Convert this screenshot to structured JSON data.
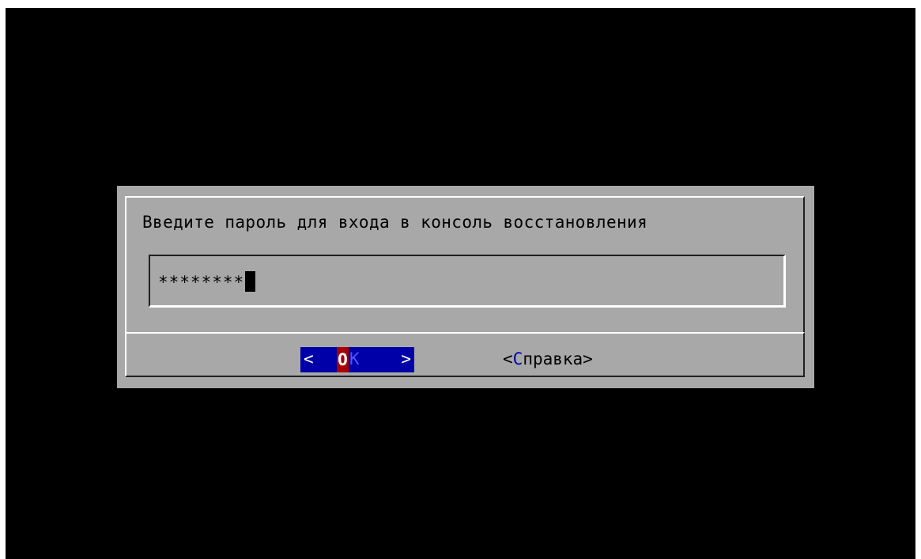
{
  "dialog": {
    "prompt": "Введите пароль для входа в консоль восстановления",
    "password_masked": "********"
  },
  "buttons": {
    "ok": {
      "left_bracket": "<",
      "hotkey": "O",
      "rest": "K",
      "right_bracket": ">"
    },
    "help": {
      "open": "<",
      "hotkey": "С",
      "rest": "правка",
      "close": ">"
    }
  },
  "colors": {
    "screen_bg": "#000000",
    "dialog_bg": "#a8a8a8",
    "button_focus_bg": "#0000a8",
    "hotkey_bg": "#a80000",
    "hotkey_text": "#0000a8"
  }
}
